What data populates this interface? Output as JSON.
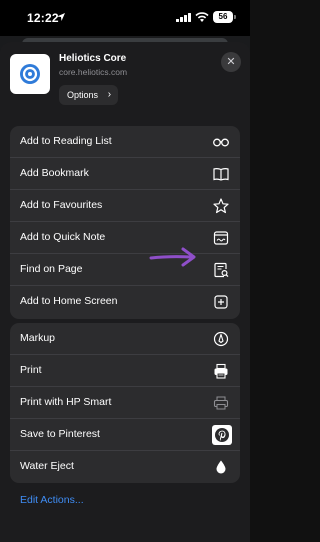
{
  "status_bar": {
    "time": "12:22",
    "battery": "56"
  },
  "site": {
    "name": "Heliotics Core",
    "url": "core.heliotics.com",
    "options_label": "Options",
    "options_chevron": "›",
    "close_glyph": "✕"
  },
  "actions_primary": [
    {
      "label": "Add to Reading List",
      "icon": "glasses-icon"
    },
    {
      "label": "Add Bookmark",
      "icon": "book-icon"
    },
    {
      "label": "Add to Favourites",
      "icon": "star-icon"
    },
    {
      "label": "Add to Quick Note",
      "icon": "quick-note-icon"
    },
    {
      "label": "Find on Page",
      "icon": "find-on-page-icon"
    },
    {
      "label": "Add to Home Screen",
      "icon": "plus-square-icon"
    }
  ],
  "actions_secondary": [
    {
      "label": "Markup",
      "icon": "markup-pen-icon"
    },
    {
      "label": "Print",
      "icon": "printer-icon"
    },
    {
      "label": "Print with HP Smart",
      "icon": "hp-printer-icon"
    },
    {
      "label": "Save to Pinterest",
      "icon": "pinterest-icon"
    },
    {
      "label": "Water Eject",
      "icon": "water-drop-icon"
    }
  ],
  "edit_actions": "Edit Actions...",
  "colors": {
    "sheet_bg": "#1c1c1e",
    "group_bg": "#2c2c2e",
    "link_blue": "#3f8df5",
    "annotation_purple": "#8f4fc9"
  }
}
